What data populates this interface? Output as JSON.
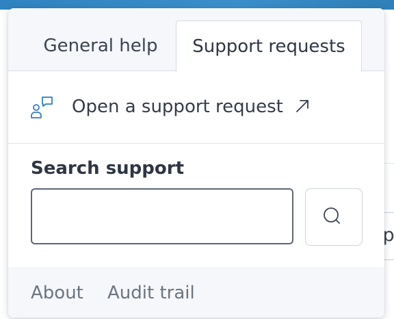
{
  "tabs": [
    {
      "label": "General help",
      "active": false
    },
    {
      "label": "Support requests",
      "active": true
    }
  ],
  "support": {
    "open_request_label": "Open a support request",
    "icons": {
      "request": "support-chat-person-icon",
      "external": "external-link-arrow-icon"
    }
  },
  "search": {
    "title": "Search support",
    "value": "",
    "placeholder": "",
    "button_icon": "search-icon"
  },
  "footer": {
    "links": [
      {
        "label": "About"
      },
      {
        "label": "Audit trail"
      }
    ]
  },
  "background": {
    "partial_text": "ip"
  },
  "colors": {
    "accent": "#2e83c0",
    "icon_blue": "#2f7fc1",
    "text": "#343c48",
    "muted_text": "#6b7480",
    "panel_footer_bg": "#f5f7fa"
  }
}
